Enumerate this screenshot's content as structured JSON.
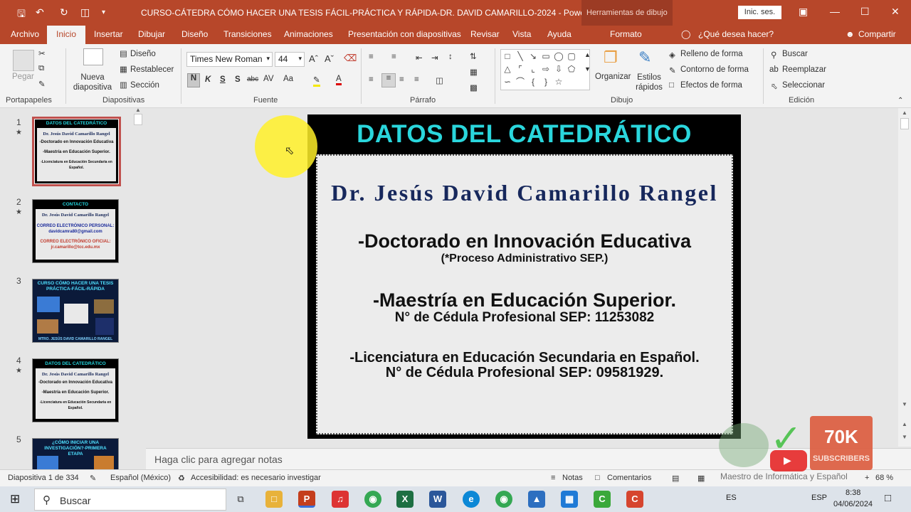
{
  "titlebar": {
    "title": "CURSO-CÁTEDRA CÓMO HACER UNA TESIS FÁCIL-PRÁCTICA Y RÁPIDA-DR. DAVID CAMARILLO-2024  -  PowerPoint",
    "context_tools": "Herramientas de dibujo",
    "signin": "Inic. ses."
  },
  "tabs": [
    "Archivo",
    "Inicio",
    "Insertar",
    "Dibujar",
    "Diseño",
    "Transiciones",
    "Animaciones",
    "Presentación con diapositivas",
    "Revisar",
    "Vista",
    "Ayuda"
  ],
  "context_tab": "Formato",
  "tell_me": "¿Qué desea hacer?",
  "share": "Compartir",
  "ribbon": {
    "portapapeles": {
      "paste": "Pegar",
      "label": "Portapapeles"
    },
    "diapositivas": {
      "new_slide": "Nueva diapositiva",
      "design": "Diseño",
      "reset": "Restablecer",
      "section": "Sección",
      "label": "Diapositivas"
    },
    "fuente": {
      "font": "Times New Roman",
      "size": "44",
      "label": "Fuente"
    },
    "parrafo": {
      "label": "Párrafo"
    },
    "dibujo": {
      "arrange": "Organizar",
      "quick_styles": "Estilos rápidos",
      "fill": "Relleno de forma",
      "outline": "Contorno de forma",
      "effects": "Efectos de forma",
      "label": "Dibujo"
    },
    "edicion": {
      "find": "Buscar",
      "replace": "Reemplazar",
      "select": "Seleccionar",
      "label": "Edición"
    }
  },
  "thumbnails": [
    {
      "num": "1",
      "star": true,
      "title": "DATOS DEL CATEDRÁTICO",
      "lines": [
        "Dr. Jesús David Camarillo Rangel",
        "-Doctorado en Innovación Educativa",
        "-Maestría en Educación Superior.",
        "-Licenciatura en Educación Secundaria en Español."
      ]
    },
    {
      "num": "2",
      "star": true,
      "title": "CONTACTO",
      "lines": [
        "Dr. Jesús David Camarillo Rangel",
        "CORREO ELECTRÓNICO PERSONAL:",
        "davidcamra80@gmail.com",
        "CORREO ELECTRÓNICO OFICIAL:",
        "jr.camarillo@tcc.edu.mx"
      ]
    },
    {
      "num": "3",
      "star": false,
      "title": "CURSO CÓMO HACER UNA TESIS PRÁCTICA-FÁCIL-RÁPIDA",
      "lines": [
        "MTRO. JESÚS DAVID CAMARILLO RANGEL"
      ]
    },
    {
      "num": "4",
      "star": true,
      "title": "DATOS DEL CATEDRÁTICO",
      "lines": [
        "Dr. Jesús David Camarillo Rangel",
        "-Doctorado en Innovación Educativa",
        "-Maestría en Educación Superior.",
        "-Licenciatura en Educación Secundaria en Español."
      ]
    },
    {
      "num": "5",
      "star": false,
      "title": "¿CÓMO INICIAR UNA INVESTIGACIÓN?-PRIMERA ETAPA",
      "lines": []
    }
  ],
  "slide": {
    "title": "DATOS DEL CATEDRÁTICO",
    "name": "Dr. Jesús David Camarillo Rangel",
    "degree1": "-Doctorado en Innovación Educativa",
    "degree1_note": "(*Proceso Administrativo SEP.)",
    "degree2": "-Maestría en Educación Superior.",
    "degree2_cedula": "N° de Cédula Profesional SEP: 11253082",
    "degree3": "-Licenciatura en Educación Secundaria en Español.",
    "degree3_cedula": "N° de Cédula Profesional SEP: 09581929."
  },
  "notes_placeholder": "Haga clic para agregar notas",
  "status": {
    "slide_info": "Diapositiva 1 de 334",
    "language": "Español (México)",
    "accessibility": "Accesibilidad: es necesario investigar",
    "notes": "Notas",
    "comments": "Comentarios",
    "zoom": "68 %"
  },
  "taskbar": {
    "search": "Buscar",
    "lang": "ES",
    "kbd": "ESP",
    "time": "8:38",
    "date": "04/06/2024"
  },
  "badge": {
    "count": "70K",
    "subs": "SUBSCRIBERS",
    "channel": "Maestro de Informática y Español"
  }
}
